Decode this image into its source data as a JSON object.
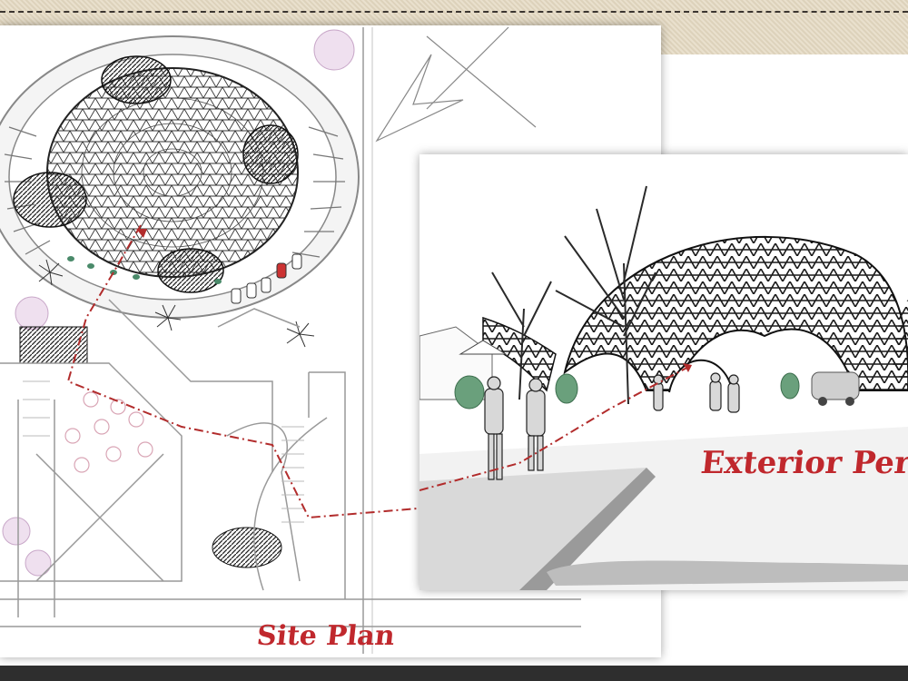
{
  "captions": {
    "site_plan": "Site Plan",
    "exterior": "Exterior Perspe"
  },
  "colors": {
    "caption_red": "#c0282d",
    "path_red": "#b22c2c",
    "line_gray": "#9a9a9a",
    "hatch_dark": "#2a2a2a"
  },
  "icons": [
    "north-arrow-icon",
    "tree-icon",
    "car-icon",
    "dome-icon"
  ]
}
